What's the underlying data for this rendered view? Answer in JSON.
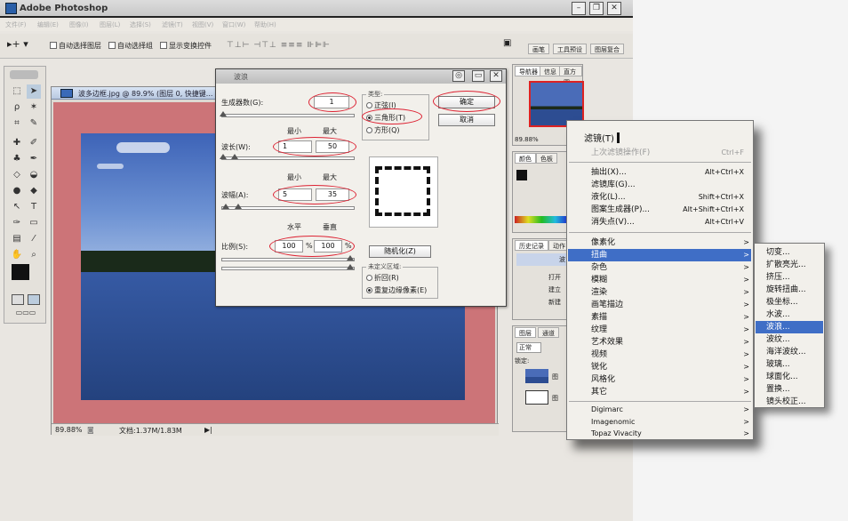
{
  "app": {
    "title": "Adobe Photoshop"
  },
  "menubar": [
    "文件(F)",
    "编辑(E)",
    "图像(I)",
    "图层(L)",
    "选择(S)",
    "滤镜(T)",
    "视图(V)",
    "窗口(W)",
    "帮助(H)"
  ],
  "options": {
    "auto_select_layer": "自动选择图层",
    "auto_select_group": "自动选择组",
    "show_transform": "显示变换控件"
  },
  "right_header_tabs": [
    "画笔",
    "工具预设",
    "图层复合"
  ],
  "document": {
    "tab_title": "波多边框.jpg @ 89.9% (图层 0, 快捷键...",
    "zoom": "89.88%",
    "doc_info": "文档:1.37M/1.83M"
  },
  "navigator": {
    "tabs": [
      "导航器",
      "信息",
      "直方图"
    ],
    "zoom": "89.88%"
  },
  "color_panel": {
    "tabs": [
      "颜色",
      "色板"
    ]
  },
  "history": {
    "tabs": [
      "历史记录",
      "动作"
    ],
    "items": [
      "波",
      "打开",
      "建立",
      "新建"
    ]
  },
  "layers": {
    "tabs": [
      "图层",
      "通道"
    ],
    "mode": "正常",
    "lock_label": "锁定:",
    "layer_names": [
      "图",
      "图"
    ]
  },
  "wave_dialog": {
    "title": "波浪",
    "generators_label": "生成器数(G):",
    "generators_value": "1",
    "min_label": "最小",
    "max_label": "最大",
    "wavelength_label": "波长(W):",
    "wavelength_min": "1",
    "wavelength_max": "50",
    "amplitude_label": "波幅(A):",
    "amplitude_min": "5",
    "amplitude_max": "35",
    "horizontal_label": "水平",
    "vertical_label": "垂直",
    "scale_label": "比例(S):",
    "scale_h": "100",
    "scale_v": "100",
    "pct": "%",
    "type_label": "类型:",
    "type_sine": "正弦(I)",
    "type_triangle": "三角形(T)",
    "type_square": "方形(Q)",
    "ok": "确定",
    "cancel": "取消",
    "randomize": "随机化(Z)",
    "undefined_label": "未定义区域:",
    "wrap_around": "折回(R)",
    "repeat_edge": "重复边缘像素(E)"
  },
  "filter_menu": {
    "header": "滤镜(T)",
    "last_filter": "上次滤镜操作(F)",
    "last_filter_sc": "Ctrl+F",
    "top_items": [
      {
        "label": "抽出(X)...",
        "sc": "Alt+Ctrl+X"
      },
      {
        "label": "滤镜库(G)...",
        "sc": ""
      },
      {
        "label": "液化(L)...",
        "sc": "Shift+Ctrl+X"
      },
      {
        "label": "图案生成器(P)...",
        "sc": "Alt+Shift+Ctrl+X"
      },
      {
        "label": "消失点(V)...",
        "sc": "Alt+Ctrl+V"
      }
    ],
    "groups": [
      "像素化",
      "扭曲",
      "杂色",
      "模糊",
      "渲染",
      "画笔描边",
      "素描",
      "纹理",
      "艺术效果",
      "视频",
      "锐化",
      "风格化",
      "其它"
    ],
    "plugins": [
      "Digimarc",
      "Imagenomic",
      "Topaz Vivacity"
    ]
  },
  "distort_submenu": [
    "切变...",
    "扩散亮光...",
    "挤压...",
    "旋转扭曲...",
    "极坐标...",
    "水波...",
    "波浪...",
    "波纹...",
    "海洋波纹...",
    "玻璃...",
    "球面化...",
    "置换...",
    "镜头校正..."
  ],
  "colors": {
    "menu_highlight": "#3f6ec6",
    "annotation_ring": "#dd2233",
    "canvas_border": "#cc7478"
  }
}
